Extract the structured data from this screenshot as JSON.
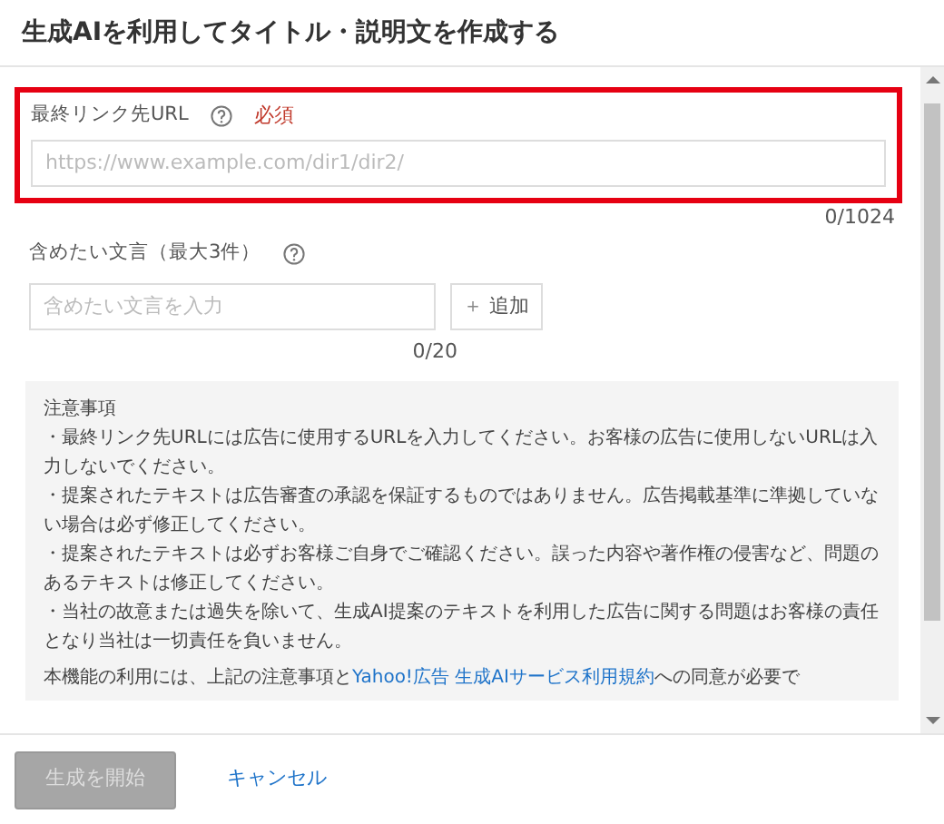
{
  "dialog": {
    "title": "生成AIを利用してタイトル・説明文を作成する"
  },
  "url_field": {
    "label": "最終リンク先URL",
    "required": "必須",
    "placeholder": "https://www.example.com/dir1/dir2/",
    "counter": "0/1024",
    "highlighted": true
  },
  "phrase_field": {
    "label": "含めたい文言（最大3件）",
    "placeholder": "含めたい文言を入力",
    "add_button": {
      "icon": "＋",
      "label": "追加"
    },
    "counter": "0/20"
  },
  "notice": {
    "heading": "注意事項",
    "items": [
      "・最終リンク先URLには広告に使用するURLを入力してください。お客様の広告に使用しないURLは入力しないでください。",
      "・提案されたテキストは広告審査の承認を保証するものではありません。広告掲載基準に準拠していない場合は必ず修正してください。",
      "・提案されたテキストは必ずお客様ご自身でご確認ください。誤った内容や著作権の侵害など、問題のあるテキストは修正してください。",
      "・当社の故意または過失を除いて、生成AI提案のテキストを利用した広告に関する問題はお客様の責任となり当社は一切責任を負いません。"
    ],
    "agreement": {
      "before": "本機能の利用には、上記の注意事項と",
      "link": "Yahoo!広告 生成AIサービス利用規約",
      "after": "への同意が必要で"
    }
  },
  "footer": {
    "primary": {
      "label": "生成を開始",
      "disabled": true
    },
    "cancel": "キャンセル"
  }
}
